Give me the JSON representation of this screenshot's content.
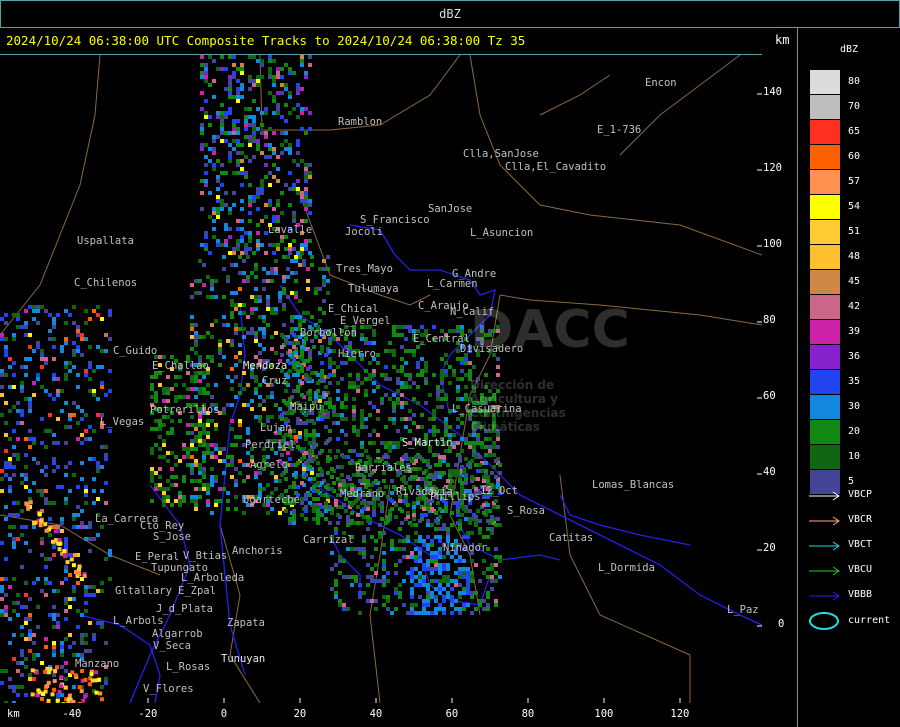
{
  "window": {
    "title": "dBZ"
  },
  "header": {
    "title": "2024/10/24 06:38:00 UTC Composite Tracks to 2024/10/24 06:38:00 Tz 35",
    "km_label": "km"
  },
  "axes": {
    "y_ticks": [
      "140",
      "120",
      "100",
      "80",
      "60",
      "40",
      "20",
      "0"
    ],
    "x_ticks": [
      "-40",
      "-20",
      "0",
      "20",
      "40",
      "60",
      "80",
      "100",
      "120"
    ],
    "x_km_label": "km"
  },
  "legend": {
    "title": "dBZ",
    "bins": [
      {
        "label": "80",
        "color": "#dcdcdc"
      },
      {
        "label": "70",
        "color": "#bebebe"
      },
      {
        "label": "65",
        "color": "#ff3020"
      },
      {
        "label": "60",
        "color": "#ff6000"
      },
      {
        "label": "57",
        "color": "#ff9050"
      },
      {
        "label": "54",
        "color": "#ffff00"
      },
      {
        "label": "51",
        "color": "#ffcc33"
      },
      {
        "label": "48",
        "color": "#ffc030"
      },
      {
        "label": "45",
        "color": "#cc8844"
      },
      {
        "label": "42",
        "color": "#cc6688"
      },
      {
        "label": "39",
        "color": "#cc22aa"
      },
      {
        "label": "36",
        "color": "#8822cc"
      },
      {
        "label": "35",
        "color": "#2244ee"
      },
      {
        "label": "30",
        "color": "#1188dd"
      },
      {
        "label": "20",
        "color": "#118811"
      },
      {
        "label": "10",
        "color": "#116611"
      },
      {
        "label": "5",
        "color": "#444499"
      }
    ],
    "tracks": [
      {
        "label": "VBCP",
        "color": "#ffffff"
      },
      {
        "label": "VBCR",
        "color": "#ffaa88"
      },
      {
        "label": "VBCT",
        "color": "#22dddd"
      },
      {
        "label": "VBCU",
        "color": "#22cc22"
      },
      {
        "label": "VBBB",
        "color": "#2222ee"
      }
    ],
    "current_label": "current",
    "current_color": "#22dddd"
  },
  "places": [
    {
      "name": "Ramblon",
      "kind": "town"
    },
    {
      "name": "Encon",
      "kind": "town"
    },
    {
      "name": "E_1-736",
      "kind": "town"
    },
    {
      "name": "Clla,SanJose",
      "kind": "town"
    },
    {
      "name": "Clla,El_Cavadito",
      "kind": "town"
    },
    {
      "name": "SanJose",
      "kind": "town"
    },
    {
      "name": "S_Francisco",
      "kind": "town"
    },
    {
      "name": "Jocoli",
      "kind": "town"
    },
    {
      "name": "Lavalle",
      "kind": "town"
    },
    {
      "name": "L_Asuncion",
      "kind": "town"
    },
    {
      "name": "Uspallata",
      "kind": "town"
    },
    {
      "name": "Tres_Mayo",
      "kind": "town"
    },
    {
      "name": "G_Andre",
      "kind": "town"
    },
    {
      "name": "Tulumaya",
      "kind": "town"
    },
    {
      "name": "L_Carmen",
      "kind": "town"
    },
    {
      "name": "C_Chilenos",
      "kind": "town"
    },
    {
      "name": "E_Chical",
      "kind": "town"
    },
    {
      "name": "E_Vergel",
      "kind": "town"
    },
    {
      "name": "C_Araujo",
      "kind": "town"
    },
    {
      "name": "N_Calif",
      "kind": "town"
    },
    {
      "name": "Borbollon",
      "kind": "town"
    },
    {
      "name": "E_Central",
      "kind": "town"
    },
    {
      "name": "C_Guido",
      "kind": "town"
    },
    {
      "name": "Hierro",
      "kind": "town"
    },
    {
      "name": "Divisadero",
      "kind": "town"
    },
    {
      "name": "Mendoza",
      "kind": "city"
    },
    {
      "name": "Cruz",
      "kind": "town"
    },
    {
      "name": "E_Challao",
      "kind": "town"
    },
    {
      "name": "Potrerillos",
      "kind": "town"
    },
    {
      "name": "L_Vegas",
      "kind": "town"
    },
    {
      "name": "Maipu",
      "kind": "town"
    },
    {
      "name": "Lujan",
      "kind": "town"
    },
    {
      "name": "Perdriel",
      "kind": "town"
    },
    {
      "name": "Agrelo",
      "kind": "town"
    },
    {
      "name": "Barriales",
      "kind": "town"
    },
    {
      "name": "L_Casuarina",
      "kind": "town"
    },
    {
      "name": "S_Martin",
      "kind": "city"
    },
    {
      "name": "Ugarteche",
      "kind": "town"
    },
    {
      "name": "Medrano",
      "kind": "town"
    },
    {
      "name": "Rivadavia",
      "kind": "town"
    },
    {
      "name": "La_Carrera",
      "kind": "town"
    },
    {
      "name": "Cto_Rey",
      "kind": "town"
    },
    {
      "name": "S_Jose",
      "kind": "town"
    },
    {
      "name": "Carrizal",
      "kind": "town"
    },
    {
      "name": "Anchoris",
      "kind": "town"
    },
    {
      "name": "E_Peral",
      "kind": "town"
    },
    {
      "name": "V_Btias",
      "kind": "town"
    },
    {
      "name": "Tupungato",
      "kind": "town"
    },
    {
      "name": "L_Arboleda",
      "kind": "town"
    },
    {
      "name": "Gltallary",
      "kind": "town"
    },
    {
      "name": "E_Zpal",
      "kind": "town"
    },
    {
      "name": "J_d_Plata",
      "kind": "town"
    },
    {
      "name": "L_Arbols",
      "kind": "town"
    },
    {
      "name": "Zapata",
      "kind": "town"
    },
    {
      "name": "Algarrob",
      "kind": "town"
    },
    {
      "name": "V_Seca",
      "kind": "town"
    },
    {
      "name": "Tunuyan",
      "kind": "city"
    },
    {
      "name": "Manzano",
      "kind": "town"
    },
    {
      "name": "L_Rosas",
      "kind": "town"
    },
    {
      "name": "V_Flores",
      "kind": "town"
    },
    {
      "name": "Lomas_Blancas",
      "kind": "town"
    },
    {
      "name": "S_Rosa",
      "kind": "town"
    },
    {
      "name": "Catitas",
      "kind": "town"
    },
    {
      "name": "L_Dormida",
      "kind": "town"
    },
    {
      "name": "L_Paz",
      "kind": "town"
    },
    {
      "name": "Ninador",
      "kind": "town"
    },
    {
      "name": "Phillips",
      "kind": "town"
    },
    {
      "name": "12_Oct",
      "kind": "town"
    }
  ],
  "watermark": {
    "brand": "DACC",
    "subtitle": "Dirección de Agricultura y Contingencias Climáticas"
  }
}
